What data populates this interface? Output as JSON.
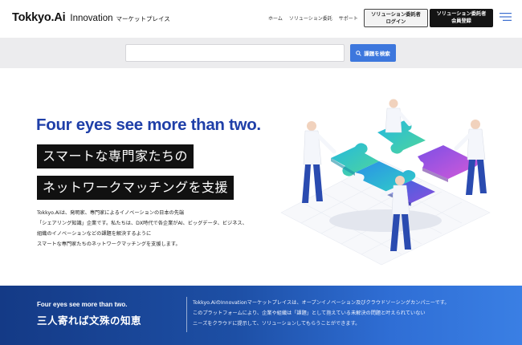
{
  "header": {
    "logo_main": "Tokkyo.Ai",
    "logo_sub": "Innovation",
    "logo_jp": "マーケットプレイス",
    "nav": [
      "ホーム",
      "ソリューション委託",
      "サポート"
    ],
    "login_line1": "ソリューション委託者",
    "login_line2": "ログイン",
    "register_line1": "ソリューション委託者",
    "register_line2": "会員登録"
  },
  "search": {
    "placeholder": "",
    "button_label": "課題を検索"
  },
  "hero": {
    "title": "Four eyes see more than two.",
    "tagline1": "スマートな専門家たちの",
    "tagline2": "ネットワークマッチングを支援",
    "desc_lines": [
      "Tokkyo.Aiは、発明家、専門家によるイノベーションの日本の先端",
      "「シェアリング知識」企業です。私たちは、DX時代で各企業がAI、ビッグデータ、ビジネス、",
      "組織のイノベーションなどの課題を解決するように",
      "スマートな専門家たちのネットワークマッチングを支援します。"
    ]
  },
  "band": {
    "en": "Four eyes see more than two.",
    "jp": "三人寄れば文殊の知恵",
    "text_lines": [
      "Tokkyo.AiのInnovationマーケットプレイスは、オープンイノベーション及びクラウドソーシングカンパニーです。",
      "このプラットフォームにより、企業や組織は「課題」として抱えている未解決の問題と叶えられていない",
      "ニーズをクラウドに提示して、ソリューションしてもらうことができます。"
    ]
  },
  "colors": {
    "brand_blue": "#1f3fa8",
    "search_button": "#3d77dd",
    "puzzle_cyan": "#25c2dc",
    "puzzle_green": "#4fd69b",
    "puzzle_purple": "#8a4de0",
    "puzzle_pink": "#d45ad8"
  }
}
